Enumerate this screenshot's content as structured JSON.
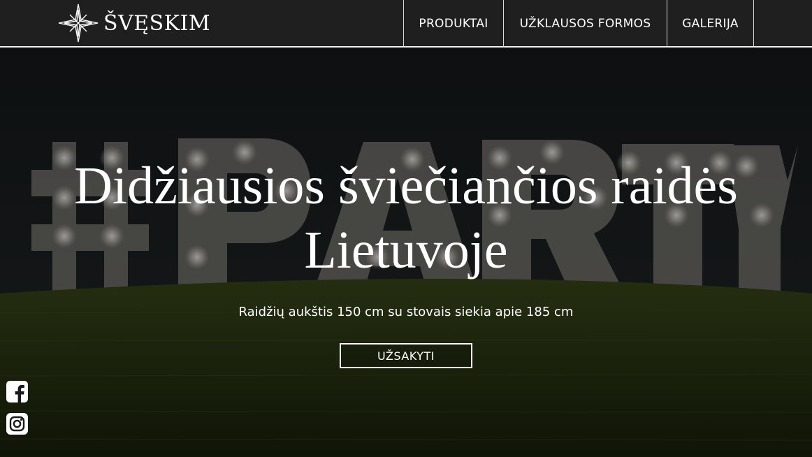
{
  "header": {
    "logo_text": "ŠVĘSKIM",
    "nav": [
      {
        "label": "PRODUKTAI"
      },
      {
        "label": "UŽKLAUSOS FORMOS"
      },
      {
        "label": "GALERIJA"
      }
    ]
  },
  "hero": {
    "title_line1": "Didžiausios šviečiančios raidės",
    "title_line2": "Lietuvoje",
    "subtitle": "Raidžių aukštis 150 cm su stovais siekia apie 185 cm",
    "button_label": "UŽSAKYTI",
    "background_image": "illuminated marquee letters #PARTY on grass at night"
  },
  "social": {
    "facebook_icon": "facebook-icon",
    "instagram_icon": "instagram-icon"
  },
  "colors": {
    "header_bg": "#1f1f1f",
    "text": "#ffffff",
    "divider": "#d9d9d9"
  }
}
